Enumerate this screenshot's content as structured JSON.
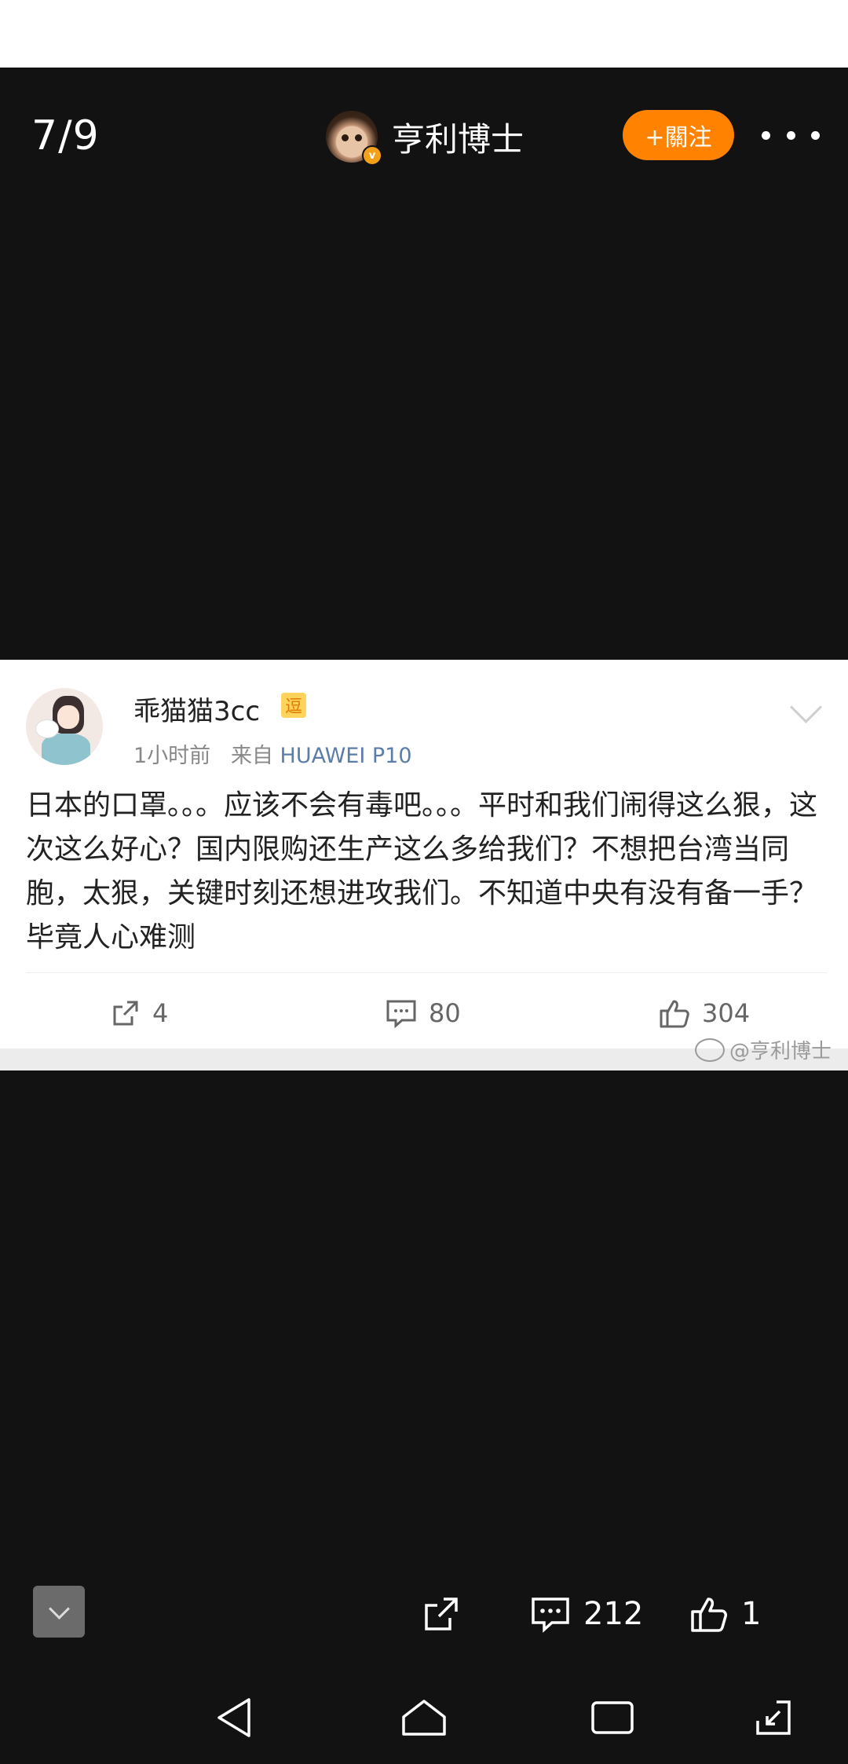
{
  "viewer": {
    "counter": "7/9",
    "author_name": "亨利博士",
    "verified_mark": "v",
    "follow_label": "+關注"
  },
  "post": {
    "username": "乖猫猫3cc",
    "badge": "逗",
    "time": "1小时前",
    "source_prefix": "来自",
    "source_device": "HUAWEI P10",
    "text": "日本的口罩。。。应该不会有毒吧。。。平时和我们闹得这么狠，这次这么好心？国内限购还生产这么多给我们？不想把台湾当同胞，太狠，关键时刻还想进攻我们。不知道中央有没有备一手？毕竟人心难测",
    "shares": "4",
    "comments": "80",
    "likes": "304"
  },
  "watermark": "@亨利博士",
  "bottom_bar": {
    "comments": "212",
    "likes": "1"
  },
  "icons": {
    "more": "more-dots-icon",
    "share": "share-icon",
    "comment": "comment-icon",
    "like": "thumbs-up-icon",
    "collapse": "chevron-down-icon",
    "back": "nav-back-icon",
    "home": "nav-home-icon",
    "recent": "nav-recent-icon",
    "expand": "expand-icon"
  },
  "colors": {
    "background": "#121212",
    "follow_button": "#ff8200",
    "verified": "#f4a11a",
    "source_link": "#5b7da8"
  }
}
